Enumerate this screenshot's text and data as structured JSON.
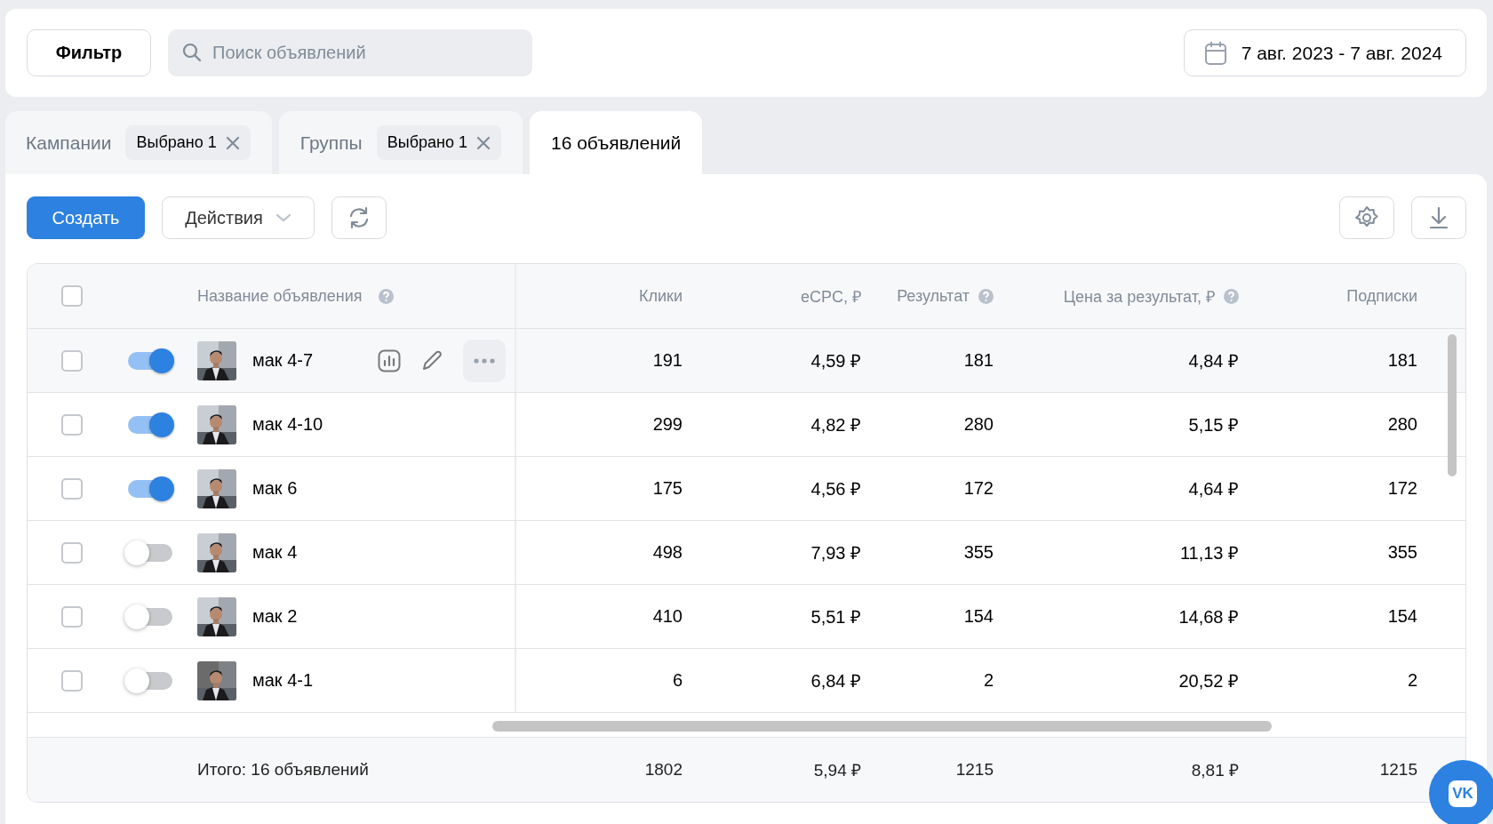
{
  "filter_button": "Фильтр",
  "search": {
    "placeholder": "Поиск объявлений"
  },
  "date_range": "7 авг. 2023 - 7 авг. 2024",
  "tabs": [
    {
      "label": "Кампании",
      "chip": "Выбрано 1",
      "selected": false
    },
    {
      "label": "Группы",
      "chip": "Выбрано 1",
      "selected": false
    },
    {
      "label": "16 объявлений",
      "selected": true
    }
  ],
  "toolbar": {
    "create_button": "Создать",
    "actions_button": "Действия"
  },
  "table": {
    "select_all_checked": false,
    "columns": [
      {
        "label": "Название объявления",
        "help": true
      },
      {
        "label": "Клики",
        "help": false
      },
      {
        "label": "eCPC, ₽",
        "help": false
      },
      {
        "label": "Результат",
        "help": true
      },
      {
        "label": "Цена за результат, ₽",
        "help": true
      },
      {
        "label": "Подписки",
        "help": false
      }
    ],
    "rows": [
      {
        "checked": false,
        "enabled": true,
        "hovered": true,
        "name": "мак 4-7",
        "values": [
          "191",
          "4,59 ₽",
          "181",
          "4,84 ₽",
          "181"
        ]
      },
      {
        "checked": false,
        "enabled": true,
        "hovered": false,
        "name": "мак 4-10",
        "values": [
          "299",
          "4,82 ₽",
          "280",
          "5,15 ₽",
          "280"
        ]
      },
      {
        "checked": false,
        "enabled": true,
        "hovered": false,
        "name": "мак 6",
        "values": [
          "175",
          "4,56 ₽",
          "172",
          "4,64 ₽",
          "172"
        ]
      },
      {
        "checked": false,
        "enabled": false,
        "hovered": false,
        "name": "мак 4",
        "values": [
          "498",
          "7,93 ₽",
          "355",
          "11,13 ₽",
          "355"
        ]
      },
      {
        "checked": false,
        "enabled": false,
        "hovered": false,
        "name": "мак 2",
        "values": [
          "410",
          "5,51 ₽",
          "154",
          "14,68 ₽",
          "154"
        ]
      },
      {
        "checked": false,
        "enabled": false,
        "hovered": false,
        "name": "мак 4-1",
        "values": [
          "6",
          "6,84 ₽",
          "2",
          "20,52 ₽",
          "2"
        ]
      }
    ],
    "total": {
      "label": "Итого: 16 объявлений",
      "values": [
        "1802",
        "5,94 ₽",
        "1215",
        "8,81 ₽",
        "1215"
      ]
    }
  },
  "vk_button": "VK"
}
